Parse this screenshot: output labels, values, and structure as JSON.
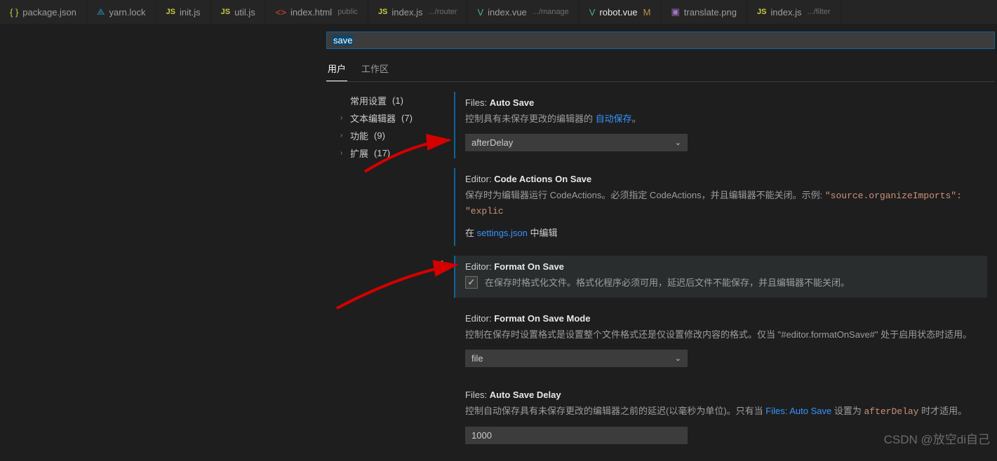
{
  "tabs": [
    {
      "icon": "json",
      "label": "package.json"
    },
    {
      "icon": "yarn",
      "label": "yarn.lock"
    },
    {
      "icon": "js",
      "label": "init.js"
    },
    {
      "icon": "js",
      "label": "util.js"
    },
    {
      "icon": "html",
      "label": "index.html",
      "hint": "public"
    },
    {
      "icon": "js",
      "label": "index.js",
      "hint": ".../router"
    },
    {
      "icon": "vue",
      "label": "index.vue",
      "hint": ".../manage"
    },
    {
      "icon": "vue",
      "label": "robot.vue",
      "modified": "M"
    },
    {
      "icon": "img",
      "label": "translate.png"
    },
    {
      "icon": "js",
      "label": "index.js",
      "hint": ".../filter"
    }
  ],
  "search": {
    "value": "save"
  },
  "scopeTabs": {
    "user": "用户",
    "workspace": "工作区"
  },
  "toc": {
    "common": {
      "label": "常用设置",
      "count": "(1)"
    },
    "textEditor": {
      "label": "文本编辑器",
      "count": "(7)"
    },
    "features": {
      "label": "功能",
      "count": "(9)"
    },
    "extensions": {
      "label": "扩展",
      "count": "(17)"
    }
  },
  "settings": {
    "autoSave": {
      "prefix": "Files:",
      "name": "Auto Save",
      "desc1": "控制具有未保存更改的编辑器的 ",
      "link": "自动保存",
      "desc2": "。",
      "value": "afterDelay"
    },
    "codeActions": {
      "prefix": "Editor:",
      "name": "Code Actions On Save",
      "desc": "保存时为编辑器运行 CodeActions。必须指定 CodeActions，并且编辑器不能关闭。示例: ",
      "code": "\"source.organizeImports\": \"explic",
      "linkPre": "在 ",
      "link": "settings.json",
      "linkPost": " 中编辑"
    },
    "formatOnSave": {
      "prefix": "Editor:",
      "name": "Format On Save",
      "desc": "在保存时格式化文件。格式化程序必须可用，延迟后文件不能保存，并且编辑器不能关闭。"
    },
    "formatOnSaveMode": {
      "prefix": "Editor:",
      "name": "Format On Save Mode",
      "desc": "控制在保存时设置格式是设置整个文件格式还是仅设置修改内容的格式。仅当 \"#editor.formatOnSave#\" 处于启用状态时适用。",
      "value": "file"
    },
    "autoSaveDelay": {
      "prefix": "Files:",
      "name": "Auto Save Delay",
      "desc1": "控制自动保存具有未保存更改的编辑器之前的延迟(以毫秒为单位)。只有当 ",
      "link": "Files: Auto Save",
      "desc2": " 设置为 ",
      "code": "afterDelay",
      "desc3": " 时才适用。",
      "value": "1000"
    }
  },
  "watermark": "CSDN @放空di自己"
}
